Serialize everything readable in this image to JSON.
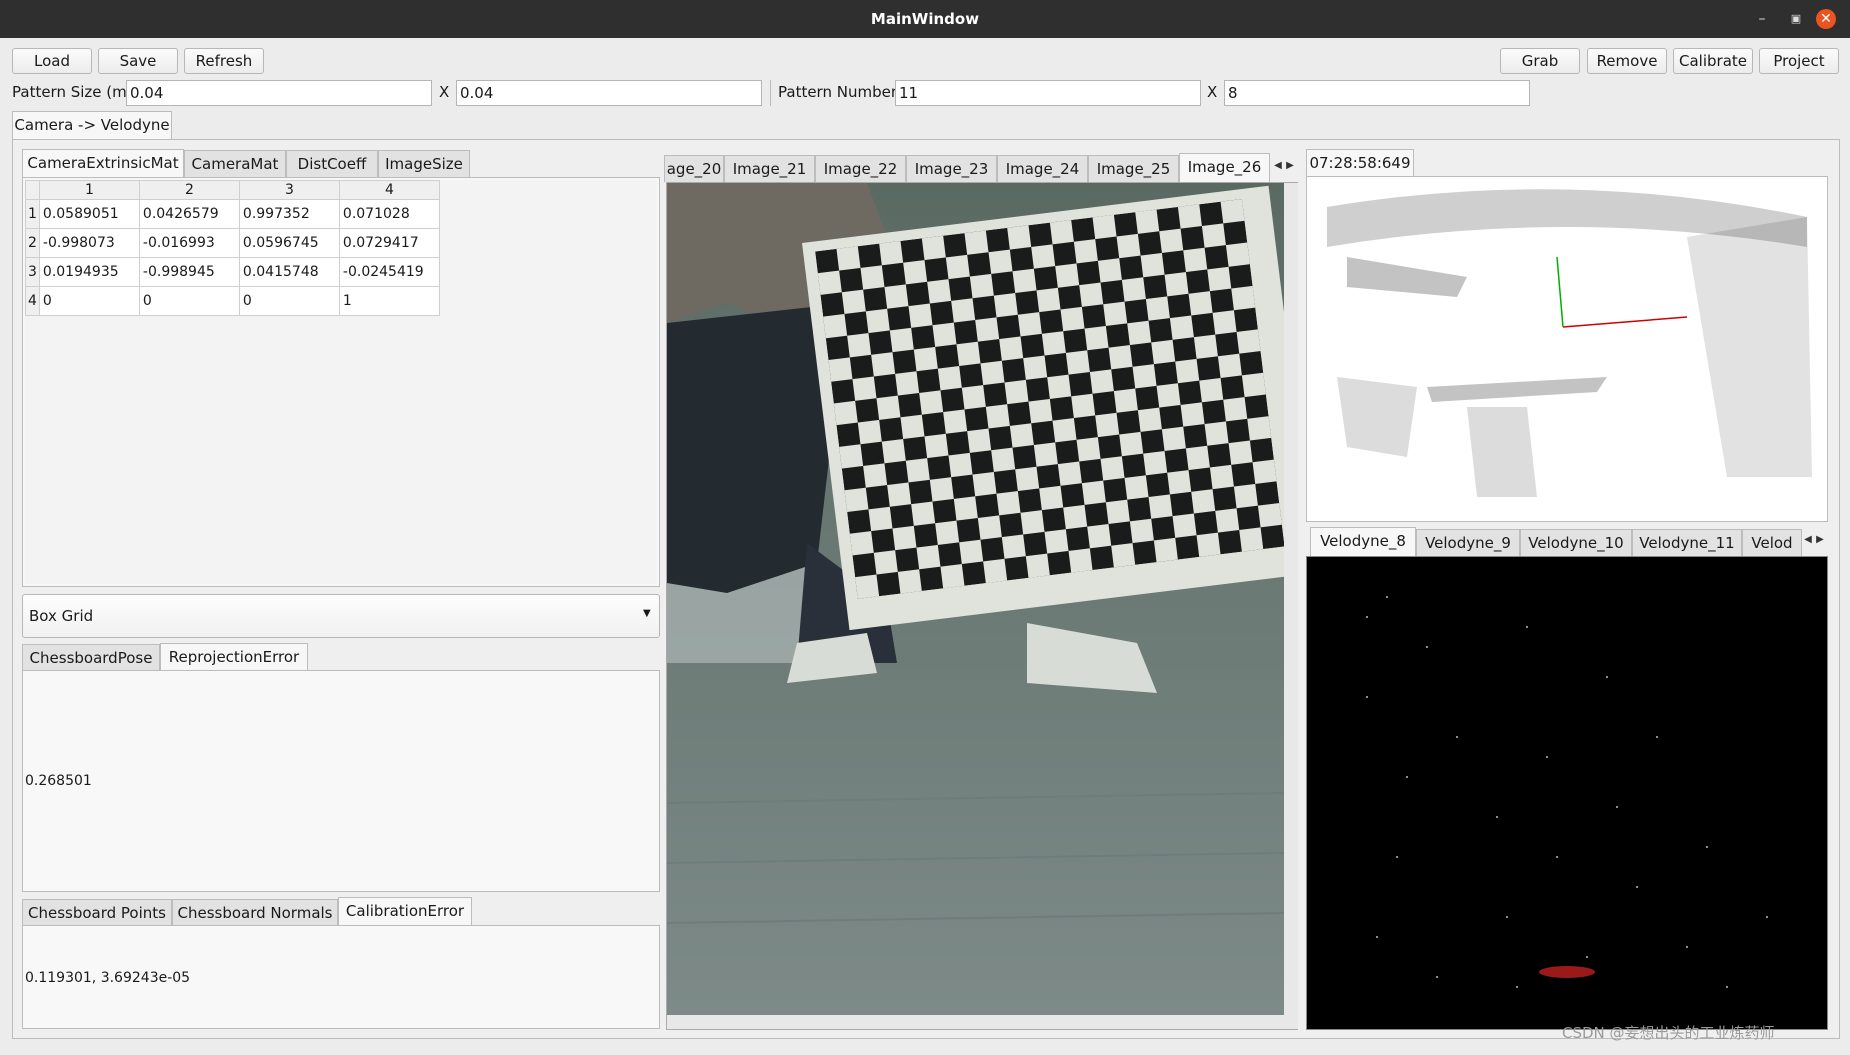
{
  "window": {
    "title": "MainWindow"
  },
  "toolbar": {
    "load": "Load",
    "save": "Save",
    "refresh": "Refresh",
    "grab": "Grab",
    "remove": "Remove",
    "calibrate": "Calibrate",
    "project": "Project"
  },
  "pattern": {
    "size_label": "Pattern Size (m)",
    "size_x": "0.04",
    "x_sep": "X",
    "size_y": "0.04",
    "number_label": "Pattern Number",
    "number_x": "11",
    "number_y": "8"
  },
  "main_tab": "Camera -> Velodyne",
  "matrix_tabs": [
    "CameraExtrinsicMat",
    "CameraMat",
    "DistCoeff",
    "ImageSize"
  ],
  "matrix": {
    "columns": [
      "1",
      "2",
      "3",
      "4"
    ],
    "rows": [
      {
        "header": "1",
        "cells": [
          "0.0589051",
          "0.0426579",
          "0.997352",
          "0.071028"
        ]
      },
      {
        "header": "2",
        "cells": [
          "-0.998073",
          "-0.016993",
          "0.0596745",
          "0.0729417"
        ]
      },
      {
        "header": "3",
        "cells": [
          "0.0194935",
          "-0.998945",
          "0.0415748",
          "-0.0245419"
        ]
      },
      {
        "header": "4",
        "cells": [
          "0",
          "0",
          "0",
          "1"
        ]
      }
    ]
  },
  "combo": {
    "value": "Box Grid"
  },
  "pose_tabs": [
    "ChessboardPose",
    "ReprojectionError"
  ],
  "reprojection_error": "0.268501",
  "calib_tabs": [
    "Chessboard Points",
    "Chessboard Normals",
    "CalibrationError"
  ],
  "calibration_error": "0.119301, 3.69243e-05",
  "image_tabs": [
    "age_20",
    "Image_21",
    "Image_22",
    "Image_23",
    "Image_24",
    "Image_25",
    "Image_26"
  ],
  "timestamp_tab": "07:28:58:649",
  "velodyne_tabs": [
    "Velodyne_8",
    "Velodyne_9",
    "Velodyne_10",
    "Velodyne_11",
    "Velod"
  ],
  "watermark": "CSDN @妄想出头的工业炼药师",
  "colors": {
    "titlebar": "#2f2f2f",
    "close": "#e95420",
    "axis_x": "#d00000",
    "axis_y": "#00b000"
  }
}
